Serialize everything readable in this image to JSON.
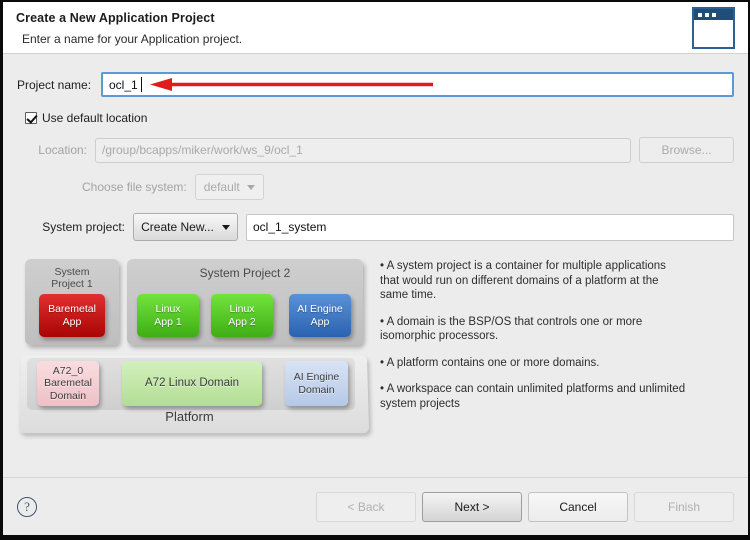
{
  "header": {
    "title": "Create a New Application Project",
    "subtitle": "Enter a name for your Application project.",
    "icon": "window-icon"
  },
  "form": {
    "project_name_label": "Project name:",
    "project_name_value": "ocl_1",
    "use_default_location_label": "Use default location",
    "use_default_location_checked": true,
    "location_label": "Location:",
    "location_value": "/group/bcapps/miker/work/ws_9/ocl_1",
    "browse_label": "Browse...",
    "file_system_label": "Choose file system:",
    "file_system_value": "default",
    "system_project_label": "System project:",
    "system_project_combo_value": "Create New...",
    "system_project_name_value": "ocl_1_system",
    "focus_border_color": "#5a9ad6",
    "annotation_arrow_color": "#e01b1b"
  },
  "diagram": {
    "system_project_1_label": "System\nProject 1",
    "system_project_1_label_l1": "System",
    "system_project_1_label_l2": "Project 1",
    "system_project_2_label": "System Project 2",
    "platform_label": "Platform",
    "apps": [
      {
        "label_l1": "Baremetal",
        "label_l2": "App",
        "color": "#c51111"
      },
      {
        "label_l1": "Linux",
        "label_l2": "App 1",
        "color": "#55c922"
      },
      {
        "label_l1": "Linux",
        "label_l2": "App 2",
        "color": "#55c922"
      },
      {
        "label_l1": "AI Engine",
        "label_l2": "App",
        "color": "#3b78c8"
      }
    ],
    "domains": [
      {
        "label_l1": "A72_0",
        "label_l2": "Baremetal",
        "label_l3": "Domain",
        "color": "#f2c9cd"
      },
      {
        "label_l1": "A72 Linux Domain",
        "label_l2": "",
        "label_l3": "",
        "color": "#c2e7a7"
      },
      {
        "label_l1": "AI Engine",
        "label_l2": "Domain",
        "label_l3": "",
        "color": "#c4d3ed"
      }
    ]
  },
  "bullets": [
    "• A system project is a container for multiple applications that would run on different domains of a platform at the same time.",
    "• A domain is the BSP/OS that controls one or more isomorphic processors.",
    "• A platform contains one or more domains.",
    "• A workspace can contain unlimited platforms and unlimited system projects"
  ],
  "footer": {
    "help_label": "?",
    "buttons": [
      {
        "label": "< Back",
        "state": "disabled"
      },
      {
        "label": "Next >",
        "state": "default"
      },
      {
        "label": "Cancel",
        "state": "normal"
      },
      {
        "label": "Finish",
        "state": "disabled"
      }
    ]
  }
}
